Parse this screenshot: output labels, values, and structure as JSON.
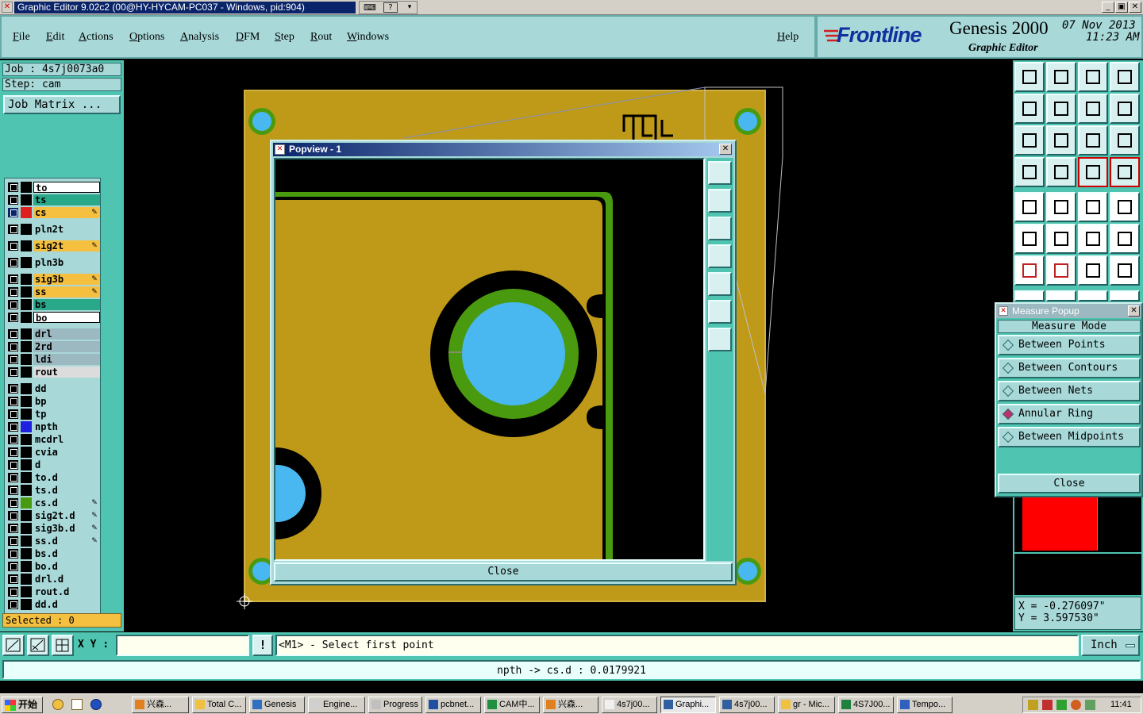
{
  "window": {
    "title": "Graphic Editor 9.02c2 (00@HY-HYCAM-PC037 - Windows, pid:904)"
  },
  "menu": {
    "items": [
      "File",
      "Edit",
      "Actions",
      "Options",
      "Analysis",
      "DFM",
      "Step",
      "Rout",
      "Windows"
    ],
    "help": "Help"
  },
  "brand": {
    "logo": "Frontline",
    "product": "Genesis 2000",
    "subtitle": "Graphic Editor",
    "date": "07 Nov 2013",
    "time": "11:23 AM"
  },
  "job": {
    "job_label": "Job : 4s7j0073a0",
    "step_label": "Step: cam",
    "matrix_button": "Job Matrix ..."
  },
  "layers": [
    {
      "name": "to",
      "color": "#ffffff",
      "edit": false,
      "group": 0
    },
    {
      "name": "ts",
      "color": "#2aa88a",
      "edit": false,
      "group": 0
    },
    {
      "name": "cs",
      "color": "#f5c040",
      "edit": true,
      "group": 0,
      "active": true
    },
    {
      "name": "pln2t",
      "color": "#a8d8d8",
      "edit": false,
      "group": 1
    },
    {
      "name": "sig2t",
      "color": "#f5c040",
      "edit": true,
      "group": 2
    },
    {
      "name": "pln3b",
      "color": "#a8d8d8",
      "edit": false,
      "group": 3
    },
    {
      "name": "sig3b",
      "color": "#f5c040",
      "edit": true,
      "group": 4
    },
    {
      "name": "ss",
      "color": "#f5c040",
      "edit": true,
      "group": 4
    },
    {
      "name": "bs",
      "color": "#2aa88a",
      "edit": false,
      "group": 4
    },
    {
      "name": "bo",
      "color": "#ffffff",
      "edit": false,
      "group": 4
    },
    {
      "name": "drl",
      "color": "#9cb8c0",
      "edit": false,
      "group": 5
    },
    {
      "name": "2rd",
      "color": "#9cb8c0",
      "edit": false,
      "group": 5
    },
    {
      "name": "ldi",
      "color": "#9cb8c0",
      "edit": false,
      "group": 5
    },
    {
      "name": "rout",
      "color": "#dcdcdc",
      "edit": false,
      "group": 5
    },
    {
      "name": "dd",
      "color": "#a8d8d8",
      "edit": false,
      "group": 6
    },
    {
      "name": "bp",
      "color": "#a8d8d8",
      "edit": false,
      "group": 6
    },
    {
      "name": "tp",
      "color": "#a8d8d8",
      "edit": false,
      "group": 6
    },
    {
      "name": "npth",
      "color": "#a8d8d8",
      "edit": false,
      "group": 6
    },
    {
      "name": "mcdrl",
      "color": "#a8d8d8",
      "edit": false,
      "group": 6
    },
    {
      "name": "cvia",
      "color": "#a8d8d8",
      "edit": false,
      "group": 6
    },
    {
      "name": "d",
      "color": "#a8d8d8",
      "edit": false,
      "group": 6
    },
    {
      "name": "to.d",
      "color": "#a8d8d8",
      "edit": false,
      "group": 6
    },
    {
      "name": "ts.d",
      "color": "#a8d8d8",
      "edit": false,
      "group": 6
    },
    {
      "name": "cs.d",
      "color": "#a8d8d8",
      "edit": true,
      "group": 6
    },
    {
      "name": "sig2t.d",
      "color": "#a8d8d8",
      "edit": true,
      "group": 6
    },
    {
      "name": "sig3b.d",
      "color": "#a8d8d8",
      "edit": true,
      "group": 6
    },
    {
      "name": "ss.d",
      "color": "#a8d8d8",
      "edit": true,
      "group": 6
    },
    {
      "name": "bs.d",
      "color": "#a8d8d8",
      "edit": false,
      "group": 6
    },
    {
      "name": "bo.d",
      "color": "#a8d8d8",
      "edit": false,
      "group": 6
    },
    {
      "name": "drl.d",
      "color": "#a8d8d8",
      "edit": false,
      "group": 6
    },
    {
      "name": "rout.d",
      "color": "#a8d8d8",
      "edit": false,
      "group": 6
    },
    {
      "name": "dd.d",
      "color": "#a8d8d8",
      "edit": false,
      "group": 6
    }
  ],
  "selected": "Selected : 0",
  "popview": {
    "title": "Popview - 1",
    "close": "Close"
  },
  "measure": {
    "title": "Measure Popup",
    "mode_label": "Measure Mode",
    "options": [
      {
        "label": "Between Points",
        "selected": false
      },
      {
        "label": "Between Contours",
        "selected": false
      },
      {
        "label": "Between Nets",
        "selected": false
      },
      {
        "label": "Annular Ring",
        "selected": true
      },
      {
        "label": "Between Midpoints",
        "selected": false
      }
    ],
    "close": "Close"
  },
  "coords": {
    "x": "X = -0.276097\"",
    "y": "Y = 3.597530\""
  },
  "command": {
    "xy_label": "X Y :",
    "xy_value": "",
    "prompt": "<M1> - Select first point",
    "units": "Inch"
  },
  "status": {
    "text": "npth -> cs.d : 0.0179921"
  },
  "taskbar": {
    "start": "开始",
    "tasks": [
      "兴森...",
      "Total C...",
      "Genesis",
      "Engine...",
      "Progress",
      "pcbnet...",
      "CAM中...",
      "兴森...",
      "4s7j00...",
      "Graphi...",
      "4s7j00...",
      "gr - Mic...",
      "4S7J00...",
      "Tempo..."
    ],
    "active_index": 9,
    "clock": "11:41"
  },
  "colors": {
    "panel": "#4fc4b0",
    "field": "#a8d8d8",
    "board": "#bf9a18",
    "pad": "#4ab8f0",
    "ring": "#4a9a10"
  }
}
